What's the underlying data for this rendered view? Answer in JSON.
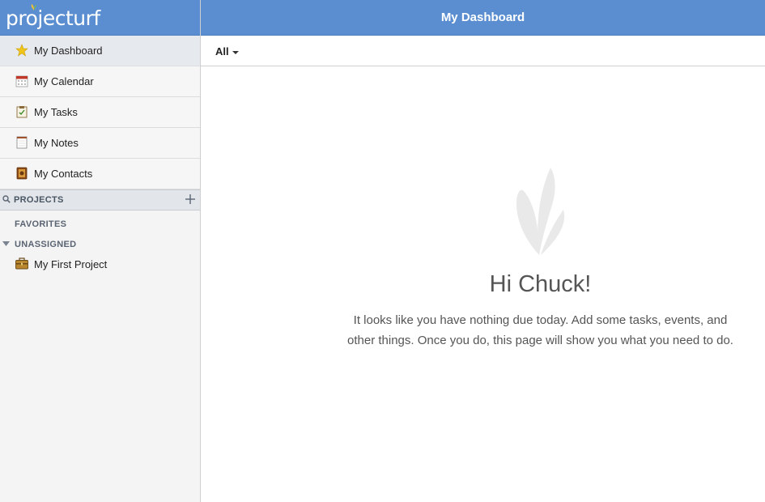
{
  "app": {
    "logo_text": "projecturf"
  },
  "header": {
    "title": "My Dashboard"
  },
  "sidebar": {
    "nav": [
      {
        "label": "My Dashboard",
        "icon": "star-icon"
      },
      {
        "label": "My Calendar",
        "icon": "calendar-icon"
      },
      {
        "label": "My Tasks",
        "icon": "clipboard-icon"
      },
      {
        "label": "My Notes",
        "icon": "notepad-icon"
      },
      {
        "label": "My Contacts",
        "icon": "address-book-icon"
      }
    ],
    "projects_title": "PROJECTS",
    "favorites_label": "FAVORITES",
    "unassigned_label": "UNASSIGNED",
    "projects": [
      {
        "label": "My First Project",
        "icon": "briefcase-icon"
      }
    ]
  },
  "filter": {
    "selected": "All"
  },
  "empty_state": {
    "title": "Hi Chuck!",
    "message": "It looks like you have nothing due today. Add some tasks, events, and other things. Once you do, this page will show you what you need to do."
  },
  "colors": {
    "brand_blue": "#5a8ed0",
    "sidebar_bg": "#f4f4f4",
    "active_bg": "#e6e9ed"
  }
}
